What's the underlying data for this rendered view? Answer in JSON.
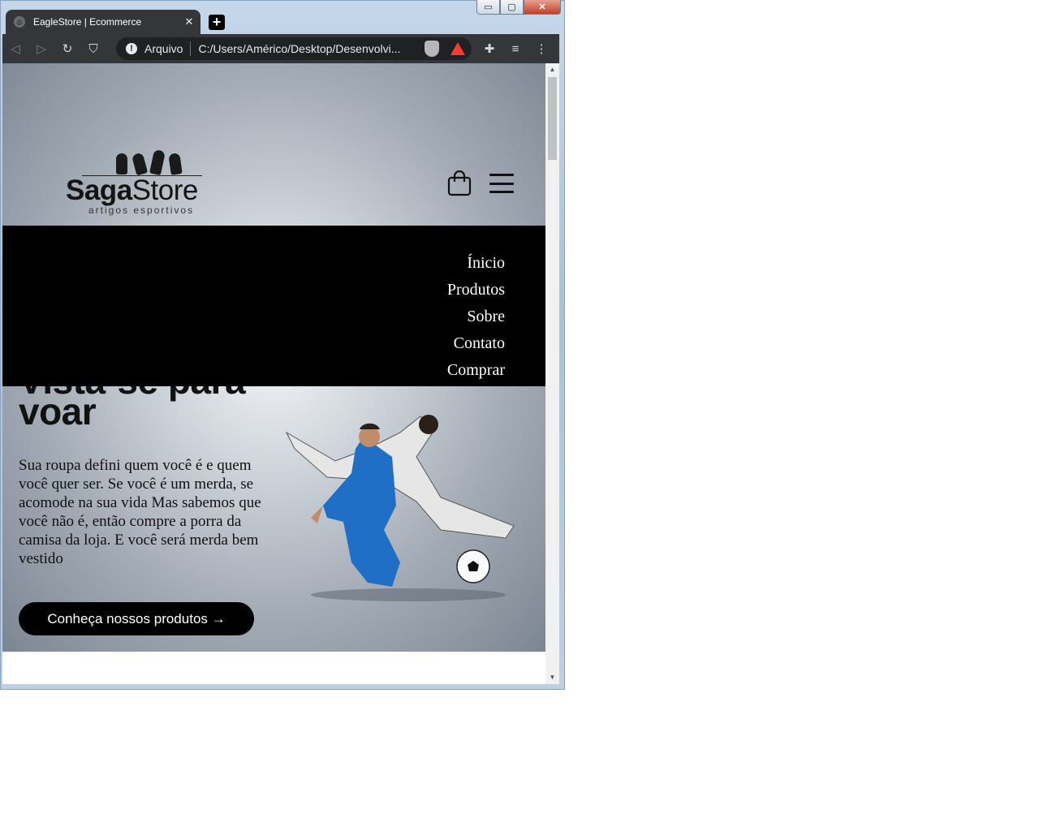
{
  "window": {
    "controls": {
      "minimize": "▭",
      "maximize": "▢",
      "close": "✕"
    }
  },
  "browser": {
    "tab_title": "EagleStore | Ecommerce",
    "tab_close": "✕",
    "new_tab": "+",
    "nav": {
      "back": "◁",
      "forward": "▷",
      "reload": "↻",
      "bookmark": "⛉"
    },
    "omnibox": {
      "info": "!",
      "scheme_label": "Arquivo",
      "url": "C:/Users/Américo/Desktop/Desenvolvi..."
    },
    "toolbar_icons": {
      "extensions": "✚",
      "media": "≡",
      "menu": "⋮"
    }
  },
  "page": {
    "logo": {
      "word_bold": "Saga",
      "word_light": "Store",
      "tagline": "artigos esportivos"
    },
    "nav_menu": [
      "Ínicio",
      "Produtos",
      "Sobre",
      "Contato",
      "Comprar"
    ],
    "hero": {
      "title": "Vista-se para voar",
      "text": "Sua roupa defini quem você é e quem você quer ser. Se você é um merda, se acomode na sua vida Mas sabemos que você não é, então compre a porra da camisa da loja. E você será merda bem vestido",
      "cta": "Conheça nossos produtos →"
    },
    "icons": [
      "cart-icon",
      "menu-icon",
      "players-image"
    ]
  }
}
